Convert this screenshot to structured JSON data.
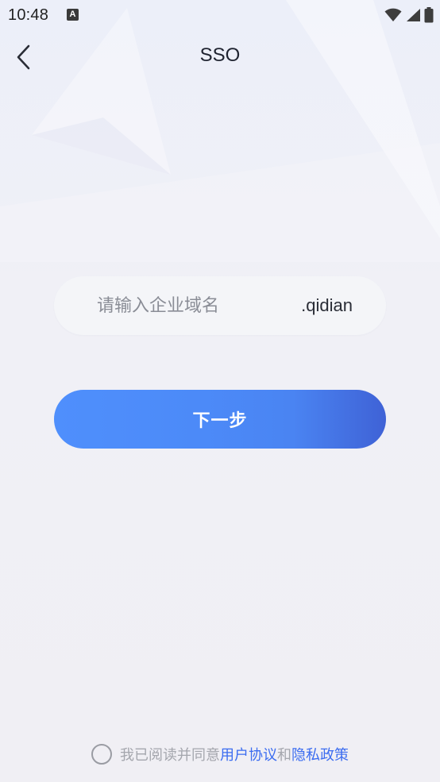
{
  "status_bar": {
    "time": "10:48",
    "notification_icon": "A"
  },
  "header": {
    "title": "SSO",
    "back_icon": "chevron-left-icon"
  },
  "domain_form": {
    "placeholder": "请输入企业域名",
    "value": "",
    "suffix": ".qidian"
  },
  "next_button": {
    "label": "下一步"
  },
  "agreement": {
    "prefix": "我已阅读并同意",
    "user_agreement": "用户协议",
    "conjunction": "和",
    "privacy_policy": "隐私政策",
    "checked": false
  },
  "colors": {
    "primary": "#4f8ffc",
    "primary_dark": "#3f62d6",
    "link": "#3b6cf0"
  }
}
